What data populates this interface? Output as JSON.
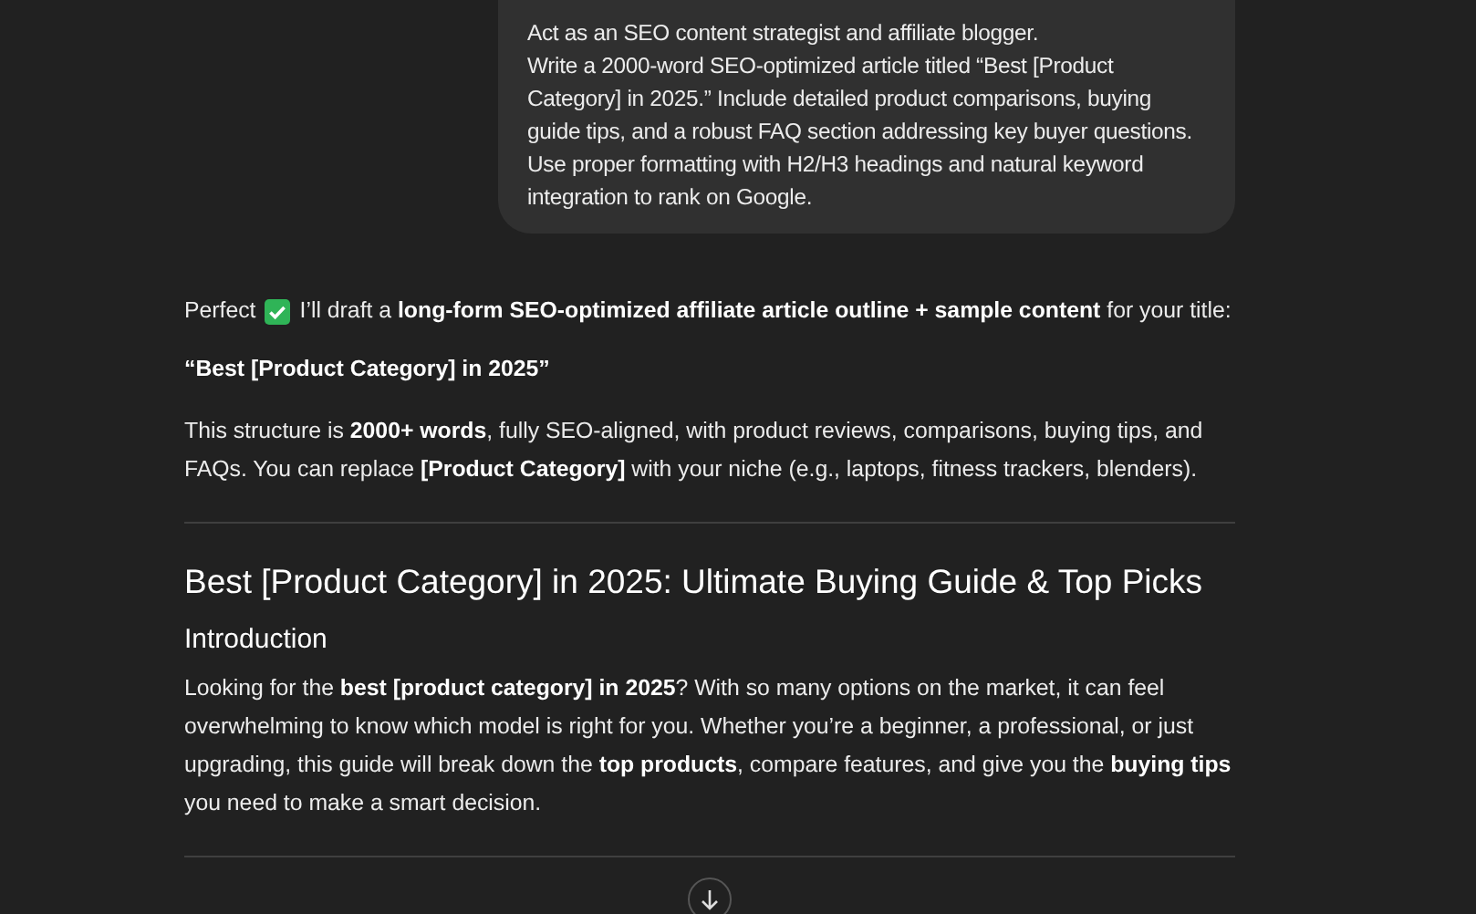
{
  "user_message": {
    "paragraphs": [
      "Act as an SEO content strategist and affiliate blogger.",
      "Write a 2000-word SEO-optimized article titled “Best [Product Category] in 2025.” Include detailed product comparisons, buying guide tips, and a robust FAQ section addressing key buyer questions. Use proper formatting with H2/H3 headings and natural keyword integration to rank on Google."
    ]
  },
  "response": {
    "blocks": [
      {
        "kind": "icon_paragraph",
        "before": "Perfect",
        "after": "I’ll draft a **long-form SEO-optimized affiliate article outline + sample content** for your title:"
      },
      {
        "kind": "bold_paragraph",
        "text": "“Best [Product Category] in 2025”"
      },
      {
        "kind": "paragraph",
        "text": "This structure is **2000+ words**, fully SEO-aligned, with product reviews, comparisons, buying tips, and FAQs. You can replace **[Product Category]** with your niche (e.g., laptops, fitness trackers, blenders)."
      },
      {
        "kind": "divider"
      },
      {
        "kind": "h2",
        "text": "Best [Product Category] in 2025: Ultimate Buying Guide & Top Picks"
      },
      {
        "kind": "h3",
        "text": "Introduction"
      },
      {
        "kind": "paragraph",
        "text": "Looking for the **best [product category] in 2025**? With so many options on the market, it can feel overwhelming to know which model is right for you. Whether you’re a beginner, a professional, or just upgrading, this guide will break down the **top products**, compare features, and give you the **buying tips** you need to make a smart decision."
      },
      {
        "kind": "divider"
      }
    ]
  },
  "scroll_down_button": {
    "visible": true
  }
}
